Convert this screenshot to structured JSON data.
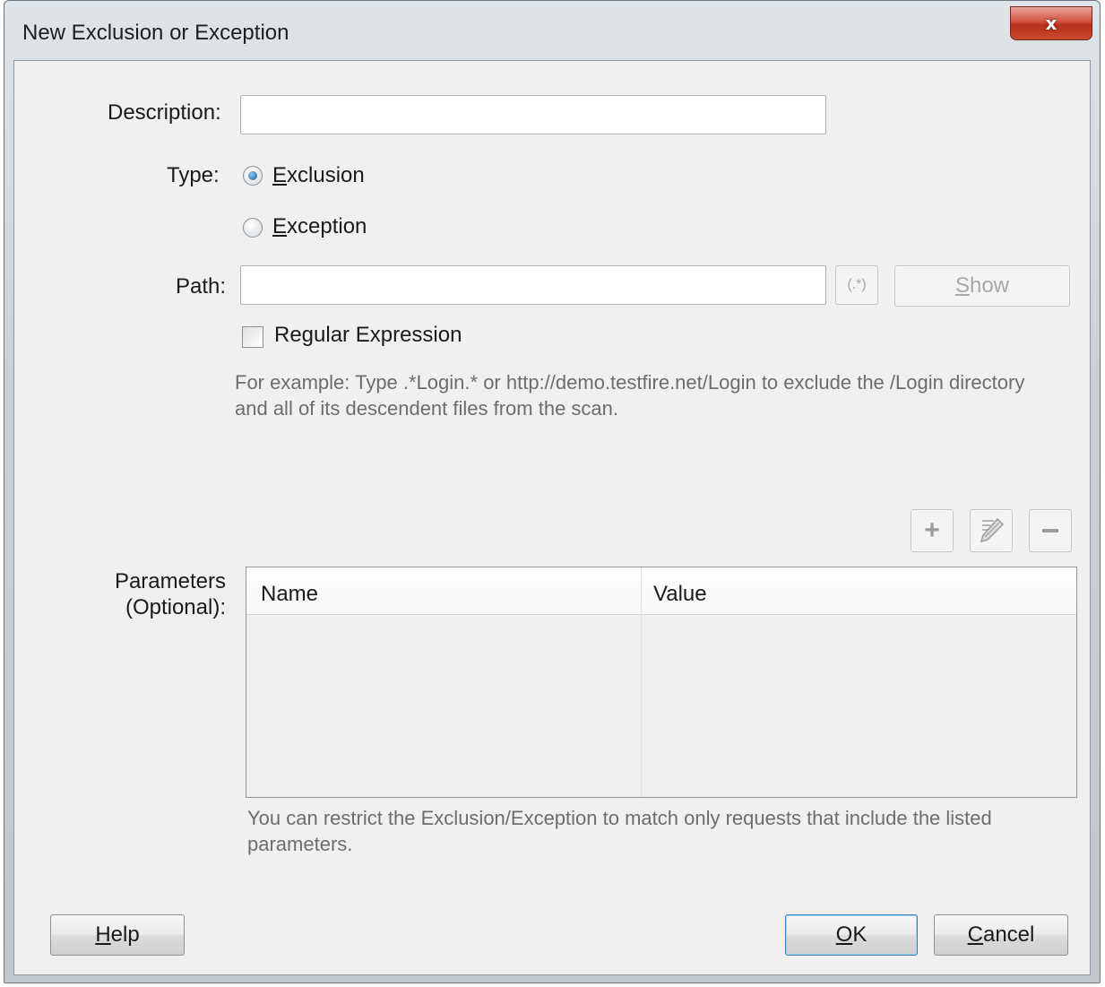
{
  "window": {
    "title": "New Exclusion or Exception",
    "close_glyph": "x"
  },
  "form": {
    "description_label": "Description:",
    "description_value": "",
    "type_label": "Type:",
    "type_options": [
      {
        "first": "E",
        "rest": "xclusion",
        "checked": true
      },
      {
        "first": "E",
        "rest": "xception",
        "checked": false
      }
    ],
    "path_label": "Path:",
    "path_value": "",
    "regex_button_label": "(.*)",
    "show_button": {
      "first": "S",
      "rest": "how"
    },
    "regex_checkbox_label": "Regular Expression",
    "regex_checked": false,
    "path_hint": "For example: Type .*Login.* or http://demo.testfire.net/Login to exclude the /Login directory and all of its descendent files from the scan."
  },
  "parameters": {
    "label_line1": "Parameters",
    "label_line2": "(Optional):",
    "columns": [
      "Name",
      "Value"
    ],
    "rows": [],
    "hint": "You can restrict the Exclusion/Exception to match only requests that include the listed parameters."
  },
  "buttons": {
    "help": {
      "first": "H",
      "rest": "elp"
    },
    "ok": {
      "first": "O",
      "rest": "K"
    },
    "cancel": {
      "first": "C",
      "rest": "ancel"
    }
  },
  "icons": {
    "add": "plus-icon",
    "edit": "pencil-icon",
    "remove": "minus-icon"
  }
}
